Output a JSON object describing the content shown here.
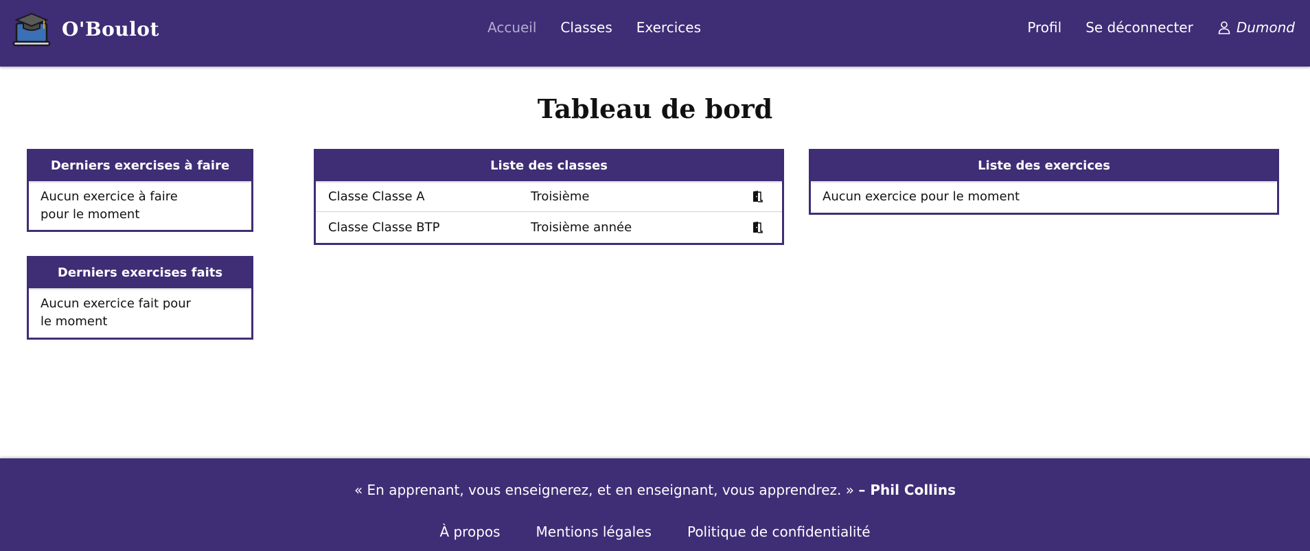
{
  "header": {
    "brand": "O'Boulot",
    "nav": [
      {
        "label": "Accueil"
      },
      {
        "label": "Classes"
      },
      {
        "label": "Exercices"
      }
    ],
    "right_nav": [
      {
        "label": "Profil"
      },
      {
        "label": "Se déconnecter"
      }
    ],
    "username": "Dumond"
  },
  "page": {
    "title": "Tableau de bord"
  },
  "todo_card": {
    "title": "Derniers exercises à faire",
    "empty_text": "Aucun exercice à faire pour le moment"
  },
  "done_card": {
    "title": "Derniers exercises faits",
    "empty_text": "Aucun exercice fait pour le moment"
  },
  "classes_card": {
    "title": "Liste des classes",
    "rows": [
      {
        "name": "Classe Classe A",
        "level": "Troisième"
      },
      {
        "name": "Classe Classe BTP",
        "level": "Troisième année"
      }
    ]
  },
  "exercises_card": {
    "title": "Liste des exercices",
    "empty_text": "Aucun exercice pour le moment"
  },
  "footer": {
    "quote": "« En apprenant, vous enseignerez, et en enseignant, vous apprendrez. »",
    "author": "– Phil Collins",
    "links": [
      {
        "label": "À propos"
      },
      {
        "label": "Mentions légales"
      },
      {
        "label": "Politique de confidentialité"
      }
    ]
  },
  "colors": {
    "primary": "#3f2d76",
    "nav_active": "#b3add0"
  },
  "icons": [
    "graduation-laptop-logo",
    "user-icon",
    "door-icon"
  ]
}
